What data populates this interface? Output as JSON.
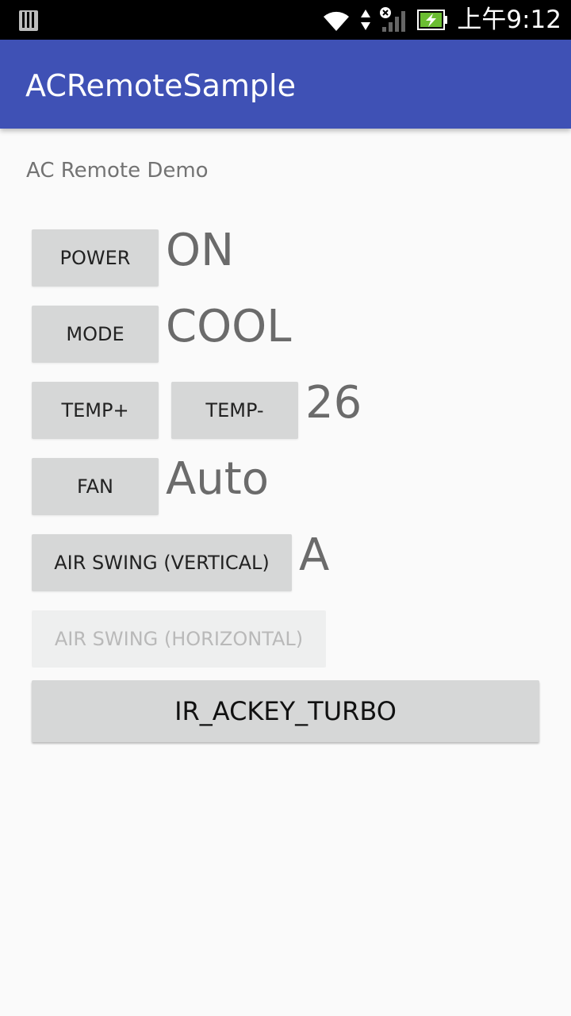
{
  "status_bar": {
    "time": "上午9:12",
    "icons": [
      "sim-card-icon",
      "wifi-icon",
      "data-arrows-icon",
      "no-signal-icon",
      "battery-charging-icon"
    ],
    "battery_color": "#6bbd32"
  },
  "app_bar": {
    "title": "ACRemoteSample",
    "color": "#3f51b5"
  },
  "main": {
    "subtitle": "AC Remote Demo",
    "power": {
      "label": "POWER",
      "value": "ON"
    },
    "mode": {
      "label": "MODE",
      "value": "COOL"
    },
    "temp": {
      "plus_label": "TEMP+",
      "minus_label": "TEMP-",
      "value": "26"
    },
    "fan": {
      "label": "FAN",
      "value": "Auto"
    },
    "air_swing_vertical": {
      "label": "AIR SWING (VERTICAL)",
      "value": "A"
    },
    "air_swing_horizontal": {
      "label": "AIR SWING (HORIZONTAL)",
      "enabled": false
    },
    "turbo": {
      "label": "IR_ACKEY_TURBO"
    }
  }
}
